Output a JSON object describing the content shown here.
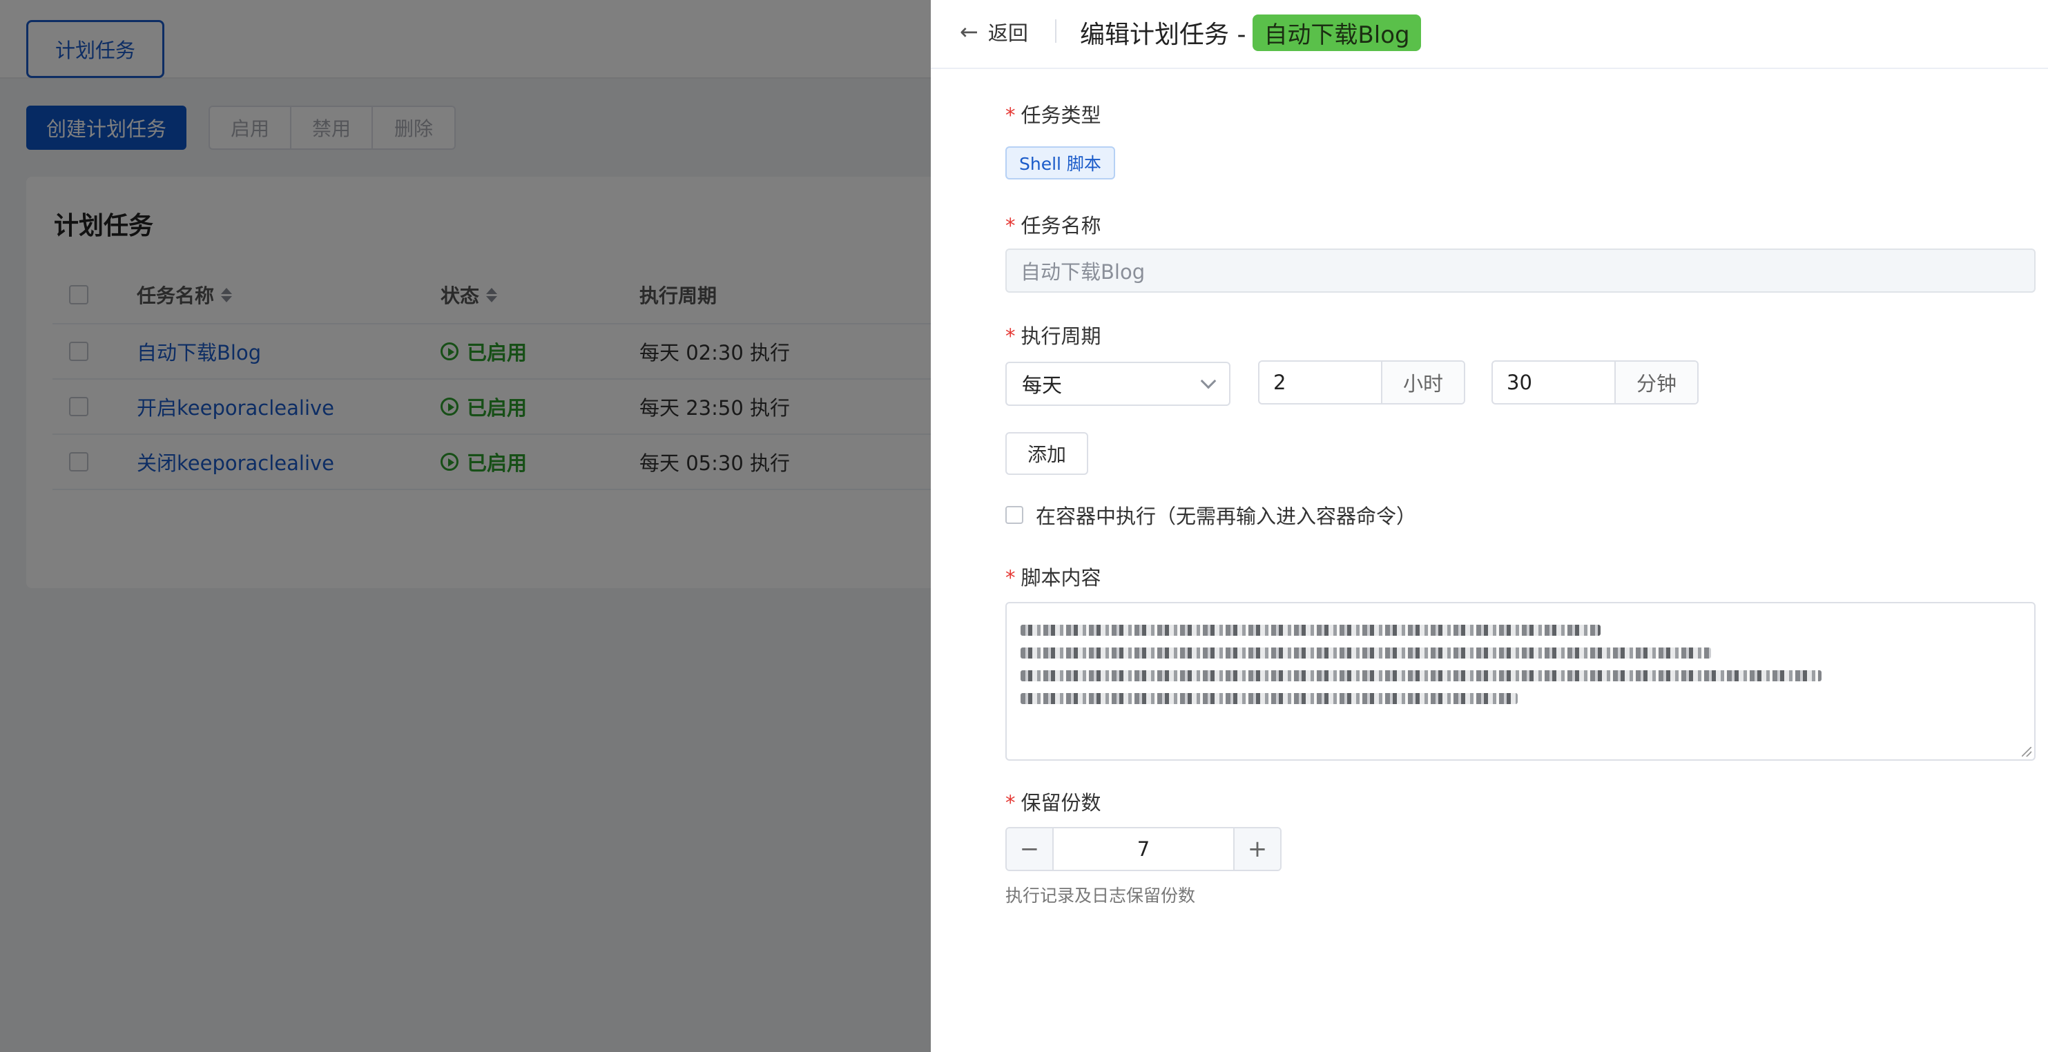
{
  "background": {
    "top_tab": "计划任务",
    "create_button": "创建计划任务",
    "toolbar": {
      "enable": "启用",
      "disable": "禁用",
      "delete": "删除"
    },
    "card_title": "计划任务",
    "table": {
      "headers": {
        "name": "任务名称",
        "status": "状态",
        "period": "执行周期"
      },
      "rows": [
        {
          "name": "自动下载Blog",
          "status": "已启用",
          "period": "每天 02:30 执行"
        },
        {
          "name": "开启keeporaclealive",
          "status": "已启用",
          "period": "每天 23:50 执行"
        },
        {
          "name": "关闭keeporaclealive",
          "status": "已启用",
          "period": "每天 05:30 执行"
        }
      ]
    }
  },
  "drawer": {
    "back_label": "返回",
    "title_prefix": "编辑计划任务 -",
    "title_badge": "自动下载Blog",
    "form": {
      "task_type": {
        "label": "任务类型",
        "value": "Shell 脚本"
      },
      "task_name": {
        "label": "任务名称",
        "value": "自动下载Blog"
      },
      "period": {
        "label": "执行周期",
        "frequency": "每天",
        "hour": "2",
        "hour_unit": "小时",
        "minute": "30",
        "minute_unit": "分钟",
        "add_button": "添加"
      },
      "in_container": {
        "label": "在容器中执行（无需再输入进入容器命令）",
        "checked": false
      },
      "script": {
        "label": "脚本内容"
      },
      "retention": {
        "label": "保留份数",
        "value": "7",
        "minus": "−",
        "plus": "+",
        "hint": "执行记录及日志保留份数"
      }
    }
  },
  "colors": {
    "primary": "#0d54c6",
    "badge": "#5ac04a",
    "enabled": "#2e9e2e",
    "required": "#e53935"
  }
}
